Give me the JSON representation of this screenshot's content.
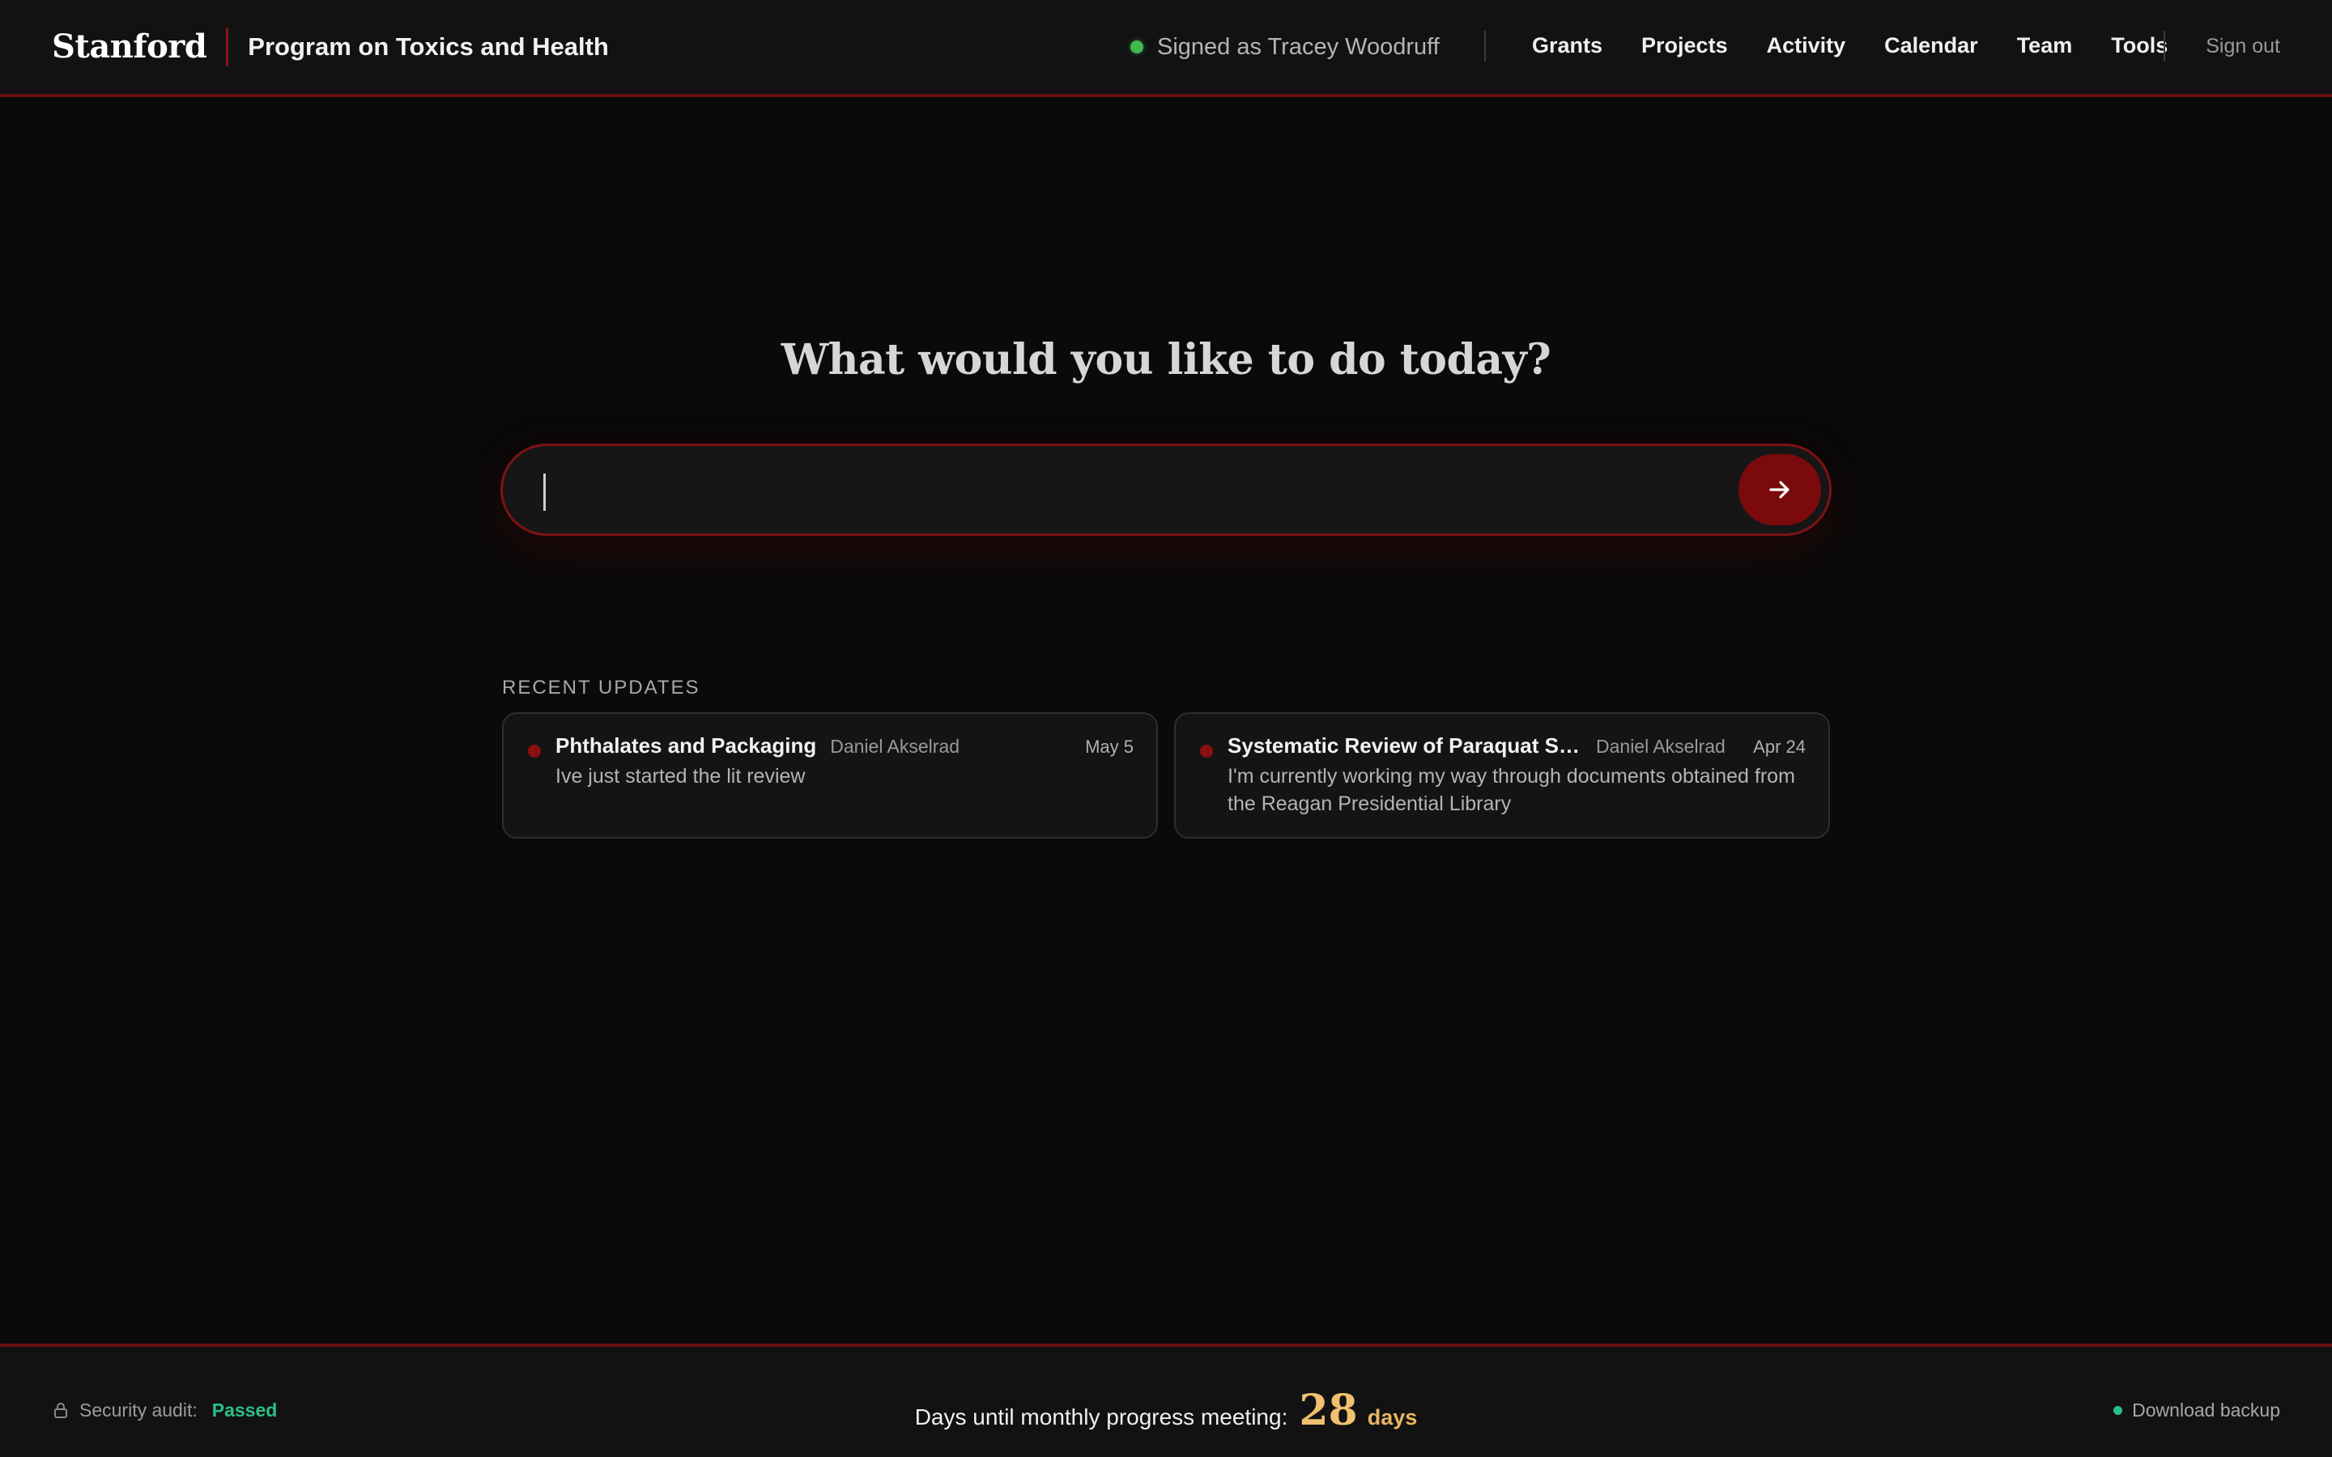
{
  "header": {
    "logo": "Stanford",
    "program_name": "Program on Toxics and Health",
    "signed_in_text": "Signed as Tracey Woodruff",
    "status_color": "#3fb950",
    "nav": [
      "Grants",
      "Projects",
      "Activity",
      "Calendar",
      "Team",
      "Tools"
    ],
    "sign_out": "Sign out"
  },
  "main": {
    "headline": "What would you like to do today?",
    "search": {
      "value": "",
      "placeholder": "",
      "submit_icon": "arrow-right-icon"
    },
    "recent_updates_label": "RECENT UPDATES",
    "updates": [
      {
        "title": "Phthalates and Packaging",
        "author": "Daniel Akselrad",
        "date": "May 5",
        "message": "Ive just started the lit review"
      },
      {
        "title": "Systematic Review of Paraquat Studi...",
        "author": "Daniel Akselrad",
        "date": "Apr 24",
        "message": "I'm currently working my way through documents obtained from the Reagan Presidential Library"
      }
    ]
  },
  "footer": {
    "security_label": "Security audit:",
    "security_status": "Passed",
    "countdown_label": "Days until monthly progress meeting:",
    "countdown_value": "28",
    "countdown_unit": "days",
    "backup_label": "Download backup"
  },
  "colors": {
    "accent": "#8c1515",
    "accent_dark": "#7a0a0c",
    "success": "#2bbf88",
    "countdown": "#f0c070"
  }
}
